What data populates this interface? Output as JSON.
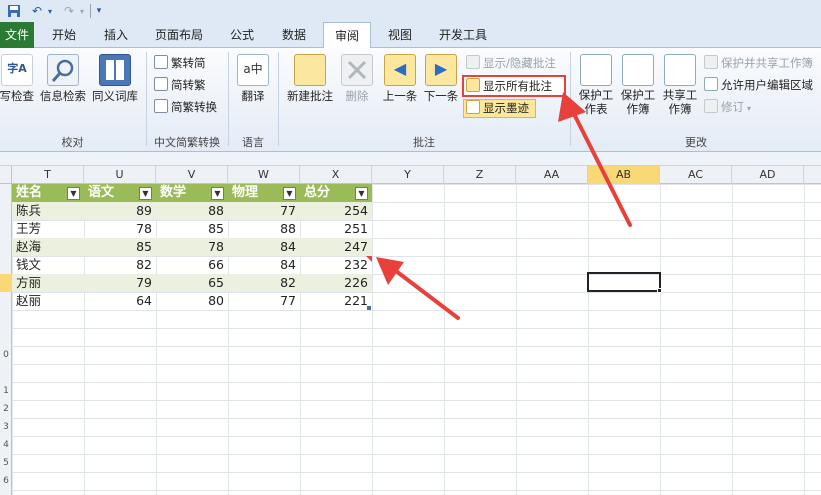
{
  "tabs": [
    "文件",
    "开始",
    "插入",
    "页面布局",
    "公式",
    "数据",
    "审阅",
    "视图",
    "开发工具"
  ],
  "groups": {
    "proofing": {
      "label": "校对",
      "buttons": [
        "拼写检查",
        "信息检索",
        "同义词库"
      ]
    },
    "chinese": {
      "label": "中文简繁转换",
      "buttons": [
        "繁转简",
        "简转繁",
        "简繁转换"
      ]
    },
    "language": {
      "label": "语言",
      "buttons": [
        "翻译"
      ]
    },
    "comments": {
      "label": "批注",
      "big": [
        "新建批注",
        "删除",
        "上一条",
        "下一条"
      ],
      "small": [
        "显示/隐藏批注",
        "显示所有批注",
        "显示墨迹"
      ]
    },
    "changes": {
      "label": "更改",
      "big": [
        "保护工作表",
        "保护工作簿",
        "共享工作簿"
      ],
      "small": [
        "保护并共享工作簿",
        "允许用户编辑区域",
        "修订"
      ]
    }
  },
  "columns": [
    "T",
    "U",
    "V",
    "W",
    "X",
    "Y",
    "Z",
    "AA",
    "AB",
    "AC",
    "AD"
  ],
  "row_numbers": [
    "",
    "",
    "",
    "",
    "",
    "",
    "",
    "",
    "0",
    "",
    "1",
    "2",
    "3",
    "4",
    "5",
    "6",
    "7"
  ],
  "table": {
    "headers": [
      "姓名",
      "语文",
      "数学",
      "物理",
      "总分"
    ],
    "rows": [
      [
        "陈兵",
        "89",
        "88",
        "77",
        "254"
      ],
      [
        "王芳",
        "78",
        "85",
        "88",
        "251"
      ],
      [
        "赵海",
        "85",
        "78",
        "84",
        "247"
      ],
      [
        "钱文",
        "82",
        "66",
        "84",
        "232"
      ],
      [
        "方丽",
        "79",
        "65",
        "82",
        "226"
      ],
      [
        "赵丽",
        "64",
        "80",
        "77",
        "221"
      ]
    ]
  },
  "colors": {
    "accent": "#2a7a33",
    "table_header": "#9bbb59",
    "band": "#ebf1de",
    "arrow": "#e8413b",
    "highlight": "#e8413b"
  }
}
